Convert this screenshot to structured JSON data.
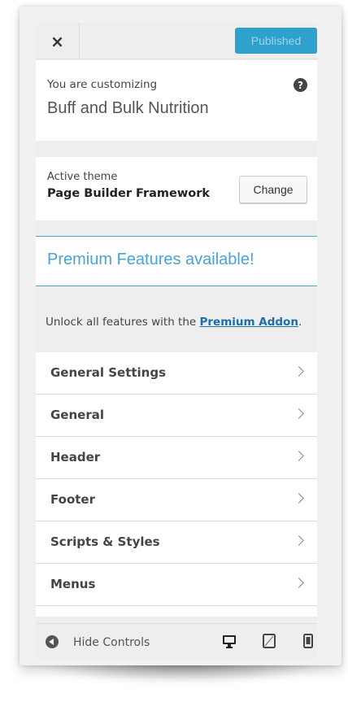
{
  "header": {
    "close_glyph": "×",
    "publish_label": "Published"
  },
  "info": {
    "label": "You are customizing",
    "site_name": "Buff and Bulk Nutrition",
    "help_glyph": "?"
  },
  "theme": {
    "label": "Active theme",
    "name": "Page Builder Framework",
    "change_label": "Change"
  },
  "premium": {
    "title": "Premium Features available!",
    "unlock_prefix": "Unlock all features with the ",
    "unlock_link": "Premium Addon",
    "unlock_suffix": "."
  },
  "menu": {
    "items": [
      {
        "label": "General Settings"
      },
      {
        "label": "General"
      },
      {
        "label": "Header"
      },
      {
        "label": "Footer"
      },
      {
        "label": "Scripts & Styles"
      },
      {
        "label": "Menus"
      }
    ]
  },
  "footer": {
    "hide_label": "Hide Controls",
    "devices": [
      "desktop-icon",
      "tablet-icon",
      "mobile-icon"
    ]
  },
  "colors": {
    "accent": "#2ea2cc",
    "premium": "#4aa3d1",
    "link": "#1e6ea7"
  }
}
